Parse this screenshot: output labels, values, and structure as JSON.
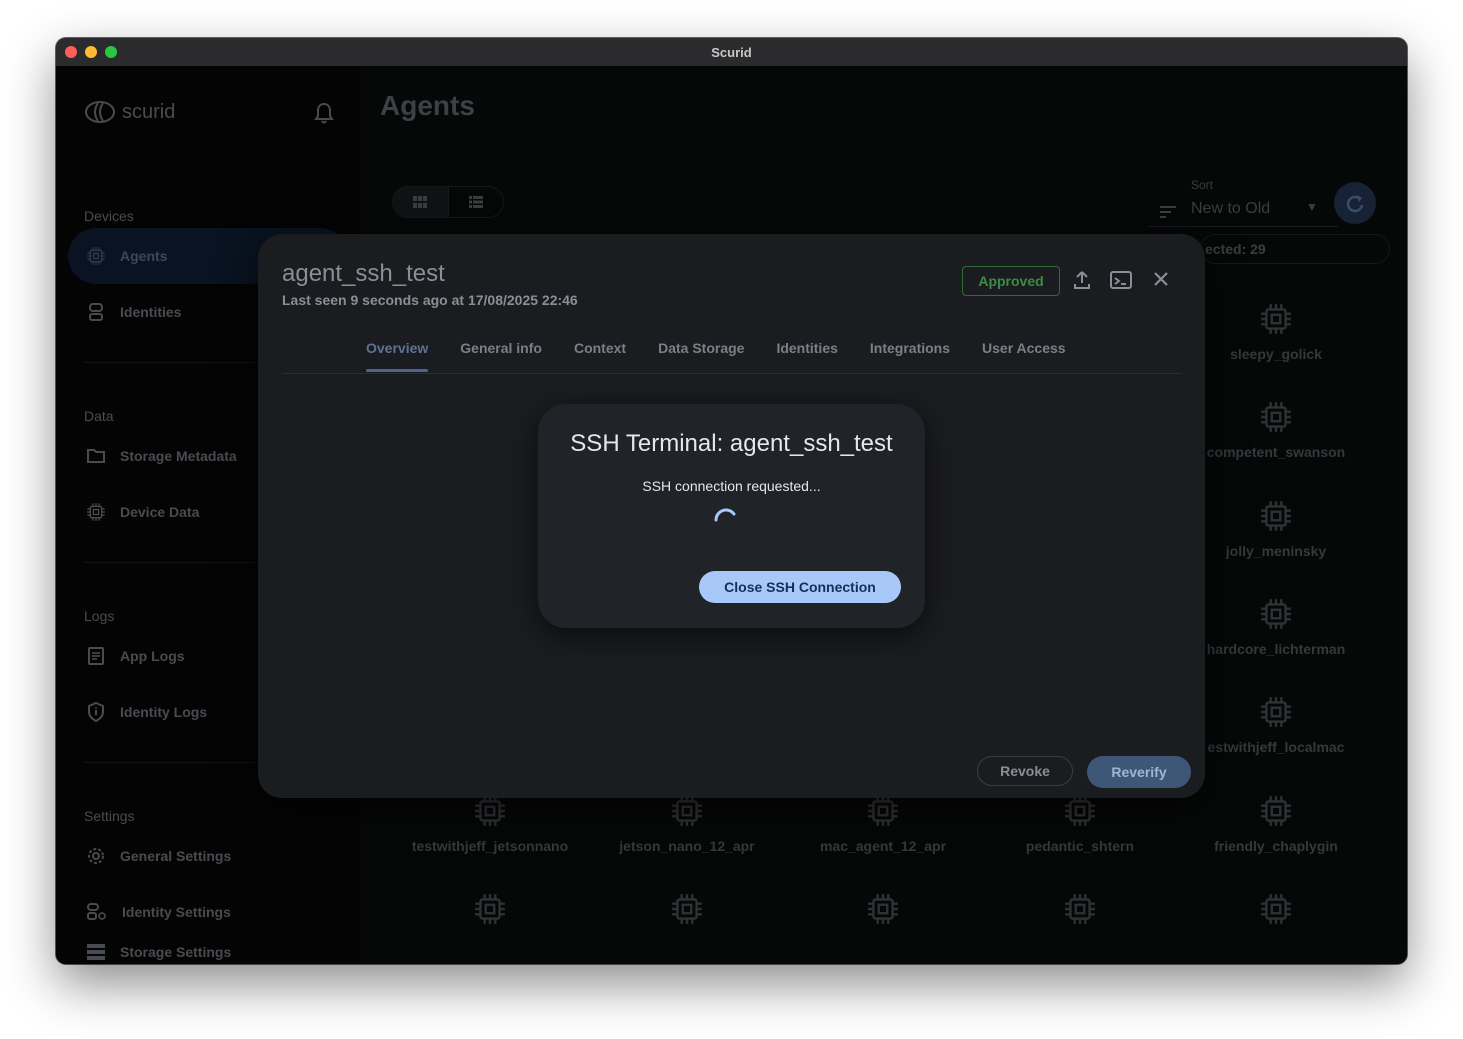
{
  "window": {
    "title": "Scurid"
  },
  "sidebar": {
    "logo_text": "scurid",
    "sections": {
      "devices": "Devices",
      "data": "Data",
      "logs": "Logs",
      "settings": "Settings"
    },
    "items": {
      "agents": "Agents",
      "identities": "Identities",
      "storage_metadata": "Storage Metadata",
      "device_data": "Device Data",
      "app_logs": "App Logs",
      "identity_logs": "Identity Logs",
      "general_settings": "General Settings",
      "identity_settings": "Identity Settings",
      "storage_settings": "Storage Settings"
    }
  },
  "main": {
    "title": "Agents",
    "sort": {
      "label": "Sort",
      "value": "New to Old"
    },
    "selected_text": "ected: 29",
    "agents_right": [
      "sleepy_golick",
      "competent_swanson",
      "jolly_meninsky",
      "hardcore_lichterman",
      "estwithjeff_localmac"
    ],
    "agents_bottom": [
      "testwithjeff_jetsonnano",
      "jetson_nano_12_apr",
      "mac_agent_12_apr",
      "pedantic_shtern",
      "friendly_chaplygin"
    ]
  },
  "modal": {
    "agent_name": "agent_ssh_test",
    "last_seen": "Last seen 9 seconds ago at 17/08/2025 22:46",
    "status": "Approved",
    "tabs": [
      "Overview",
      "General info",
      "Context",
      "Data Storage",
      "Identities",
      "Integrations",
      "User Access"
    ],
    "revoke": "Revoke",
    "reverify": "Reverify"
  },
  "ssh_dialog": {
    "title": "SSH Terminal: agent_ssh_test",
    "status": "SSH connection requested...",
    "close_button": "Close SSH Connection"
  },
  "colors": {
    "accent": "#a8c8fa",
    "approved": "#3c8c45",
    "active_nav": "#0f1e33"
  }
}
